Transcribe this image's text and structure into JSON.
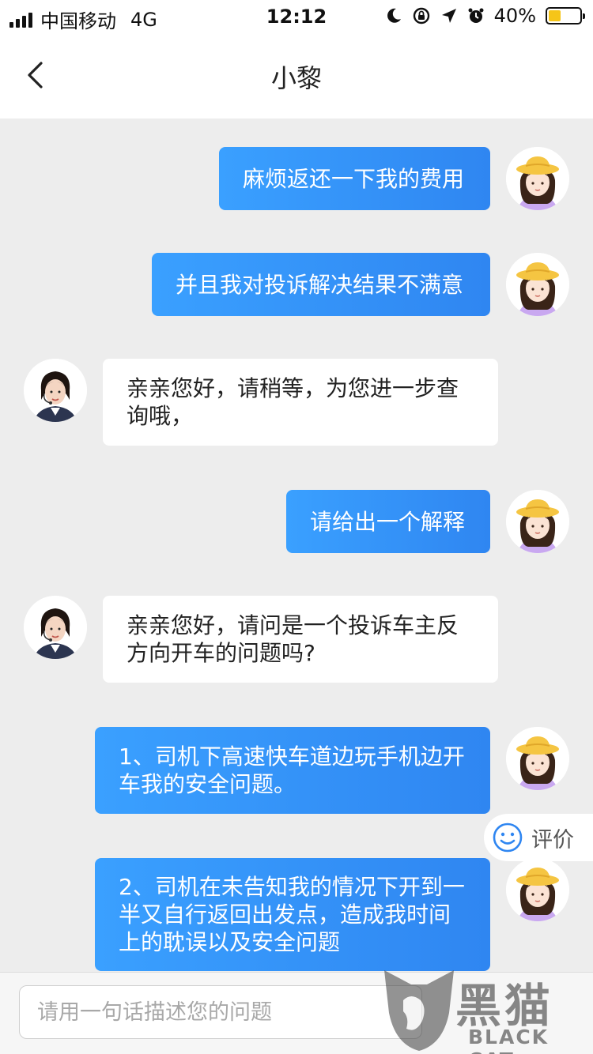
{
  "status_bar": {
    "carrier": "中国移动",
    "network": "4G",
    "time": "12:12",
    "battery_percent": "40%",
    "battery_level": 0.4,
    "icons": [
      "signal-icon",
      "moon-icon",
      "rotation-lock-icon",
      "location-icon",
      "alarm-icon",
      "battery-icon"
    ]
  },
  "nav": {
    "title": "小黎",
    "back_icon": "chevron-left-icon"
  },
  "messages": [
    {
      "from": "me",
      "text": "麻烦返还一下我的费用"
    },
    {
      "from": "me",
      "text": "并且我对投诉解决结果不满意"
    },
    {
      "from": "agent",
      "text": "亲亲您好，请稍等，为您进一步查询哦，"
    },
    {
      "from": "me",
      "text": "请给出一个解释"
    },
    {
      "from": "agent",
      "text": "亲亲您好，请问是一个投诉车主反方向开车的问题吗?"
    },
    {
      "from": "me",
      "text": "1、司机下高速快车道边玩手机边开车我的安全问题。"
    },
    {
      "from": "me",
      "text": "2、司机在未告知我的情况下开到一半又自行返回出发点，造成我时间上的耽误以及安全问题"
    }
  ],
  "rating": {
    "label": "评价",
    "icon": "smiley-icon"
  },
  "input": {
    "placeholder": "请用一句话描述您的问题",
    "value": ""
  },
  "watermark": {
    "chars": "黑猫",
    "latin": "BLACK CAT"
  },
  "colors": {
    "my_bubble": "#3197f7",
    "agent_bubble": "#ffffff",
    "background": "#ededed",
    "accent": "#2f86f1"
  }
}
